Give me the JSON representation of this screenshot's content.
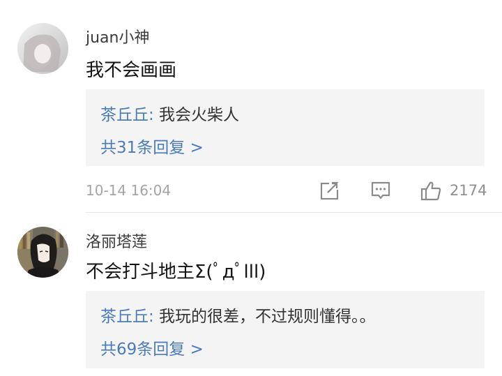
{
  "comments": [
    {
      "username": "juan小神",
      "text": "我不会画画",
      "reply_preview": {
        "author": "茶丘丘",
        "separator": ":",
        "text": " 我会火柴人",
        "more": "共31条回复 >"
      },
      "timestamp": "10-14 16:04",
      "like_count": "2174",
      "icons": [
        "share-icon",
        "comment-icon",
        "like-icon"
      ]
    },
    {
      "username": "洛丽塔莲",
      "text": "不会打斗地主Σ(ﾟдﾟlll)",
      "reply_preview": {
        "author": "茶丘丘",
        "separator": ":",
        "text": " 我玩的很差，不过规则懂得。。",
        "more": "共69条回复 >"
      }
    }
  ],
  "colors": {
    "link": "#4a7bbd",
    "reply_bg": "#f4f4f4",
    "meta_text": "#a4a4a4"
  }
}
